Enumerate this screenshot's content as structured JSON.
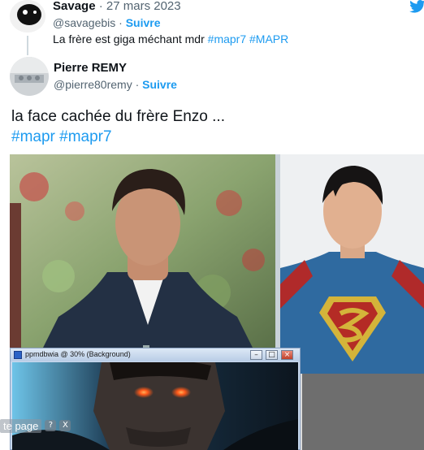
{
  "reply": {
    "name": "Savage",
    "separator": "·",
    "date": "27 mars 2023",
    "handle": "@savagebis",
    "follow_sep": "·",
    "follow": "Suivre",
    "text": "La frère est giga méchant mdr",
    "hashtags": [
      "#mapr7",
      "#MAPR"
    ]
  },
  "quoted": {
    "name": "Pierre REMY",
    "handle": "@pierre80remy",
    "follow_sep": "·",
    "follow": "Suivre",
    "text": "la face cachée du frère Enzo ...",
    "hashtags": [
      "#mapr",
      "#mapr7"
    ]
  },
  "window": {
    "title": "ppmdbwia @ 30% (Background)",
    "min_label": "–",
    "max_label": "□",
    "close_label": "×"
  },
  "page_chip": {
    "label": "te page",
    "help_label": "?",
    "close_label": "X"
  },
  "colors": {
    "accent": "#1d9bf0",
    "text": "#0f1419",
    "muted": "#536471"
  },
  "icons": {
    "brand": "twitter-bird-icon"
  }
}
